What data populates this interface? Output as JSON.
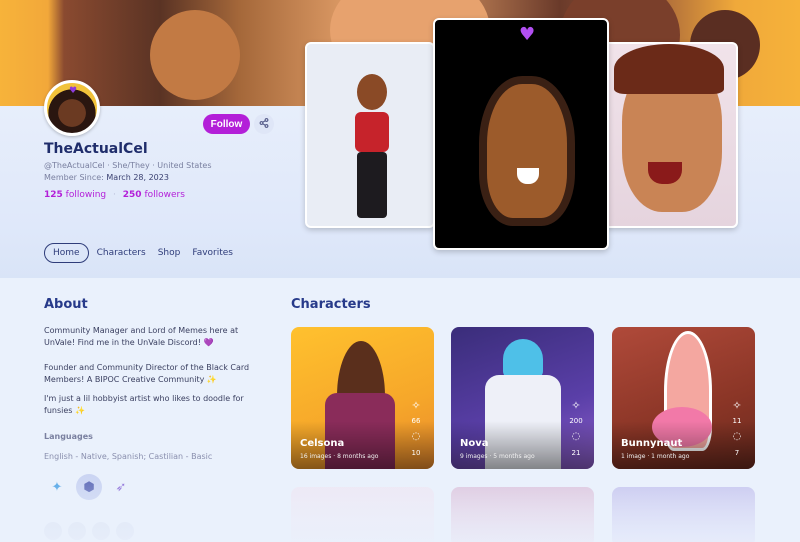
{
  "profile": {
    "username": "TheActualCel",
    "handle_line": "@TheActualCel · She/They · United States",
    "member_since_label": "Member Since:",
    "member_since_date": "March 28, 2023",
    "following_count": "125",
    "following_label": "following",
    "followers_count": "250",
    "followers_label": "followers",
    "follow_label": "Follow"
  },
  "tabs": [
    {
      "label": "Home",
      "active": true
    },
    {
      "label": "Characters",
      "active": false
    },
    {
      "label": "Shop",
      "active": false
    },
    {
      "label": "Favorites",
      "active": false
    }
  ],
  "about": {
    "title": "About",
    "paragraphs": [
      "Community Manager and Lord of Memes here at UnVale! Find me in the UnVale Discord! 💜",
      "Founder and Community Director of the Black Card Members! A BIPOC Creative Community ✨",
      "I'm just a lil hobbyist artist who likes to doodle for funsies ✨"
    ],
    "languages_title": "Languages",
    "languages_text": "English - Native, Spanish; Castilian - Basic"
  },
  "characters": {
    "title": "Characters",
    "items": [
      {
        "name": "Celsona",
        "meta": "16 images · 8 months ago",
        "favorites": "66",
        "comments": "10"
      },
      {
        "name": "Nova",
        "meta": "9 images · 5 months ago",
        "favorites": "200",
        "comments": "21"
      },
      {
        "name": "Bunnynaut",
        "meta": "1 image · 1 month ago",
        "favorites": "11",
        "comments": "7"
      }
    ]
  },
  "colors": {
    "accent": "#b31fd8",
    "title_blue": "#273a8a",
    "page_bg": "#eaf1fc"
  },
  "icons": {
    "share": "share-icon",
    "favorite": "sparkle-star-icon",
    "comment": "comment-icon"
  }
}
